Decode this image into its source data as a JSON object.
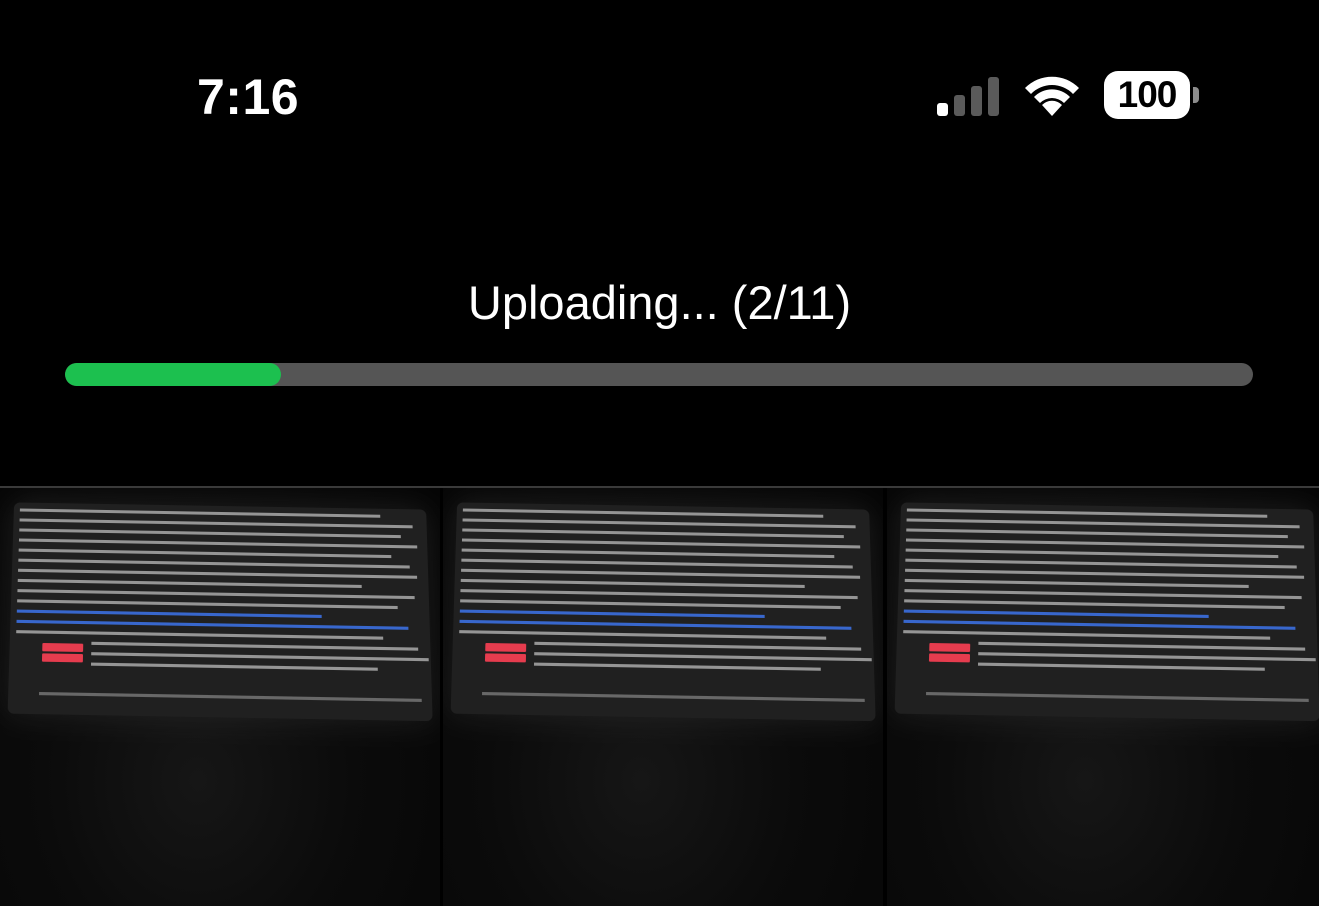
{
  "status_bar": {
    "time": "7:16",
    "battery_level": "100",
    "signal_icon": "cellular-signal-icon",
    "wifi_icon": "wifi-icon",
    "battery_icon": "battery-icon"
  },
  "upload": {
    "label": "Uploading... (2/11)",
    "current": 2,
    "total": 11,
    "progress_fraction": 0.182,
    "progress_color": "#1cc04f",
    "track_color": "#555555"
  },
  "gallery": {
    "items": [
      {
        "kind": "photo-thumbnail"
      },
      {
        "kind": "photo-thumbnail"
      },
      {
        "kind": "photo-thumbnail"
      }
    ]
  }
}
